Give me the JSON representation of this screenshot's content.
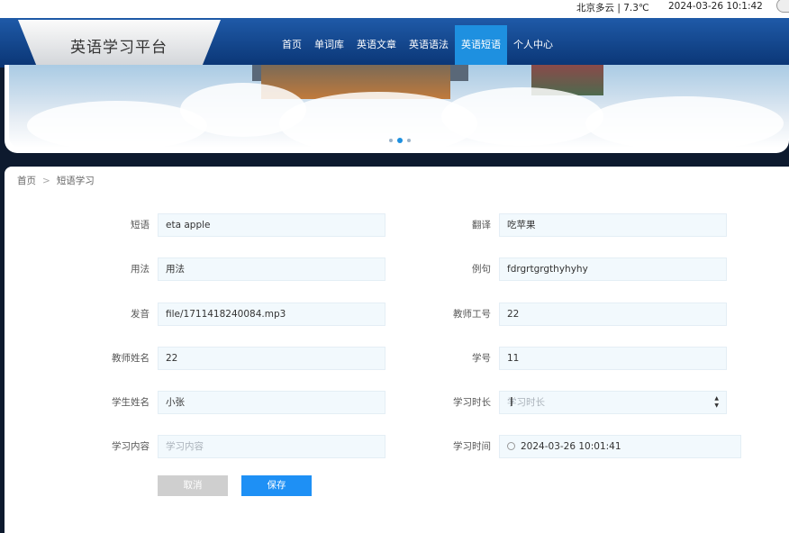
{
  "topbar": {
    "weather": "北京多云 | 7.3℃",
    "datetime": "2024-03-26  10:1:42"
  },
  "header": {
    "site_title": "英语学习平台"
  },
  "nav": [
    "首页",
    "单词库",
    "英语文章",
    "英语语法",
    "英语短语",
    "个人中心"
  ],
  "breadcrumb": {
    "home": "首页",
    "separator": ">",
    "current": "短语学习"
  },
  "form": {
    "phrase": {
      "label": "短语",
      "value": "eta  apple"
    },
    "translation": {
      "label": "翻译",
      "value": "吃苹果"
    },
    "usage": {
      "label": "用法",
      "value": "用法"
    },
    "example": {
      "label": "例句",
      "value": "fdrgrtgrgthyhyhy"
    },
    "audio": {
      "label": "发音",
      "value": "file/1711418240084.mp3"
    },
    "teacher_id": {
      "label": "教师工号",
      "value": "22"
    },
    "teacher_name": {
      "label": "教师姓名",
      "value": "22"
    },
    "student_id": {
      "label": "学号",
      "value": "11"
    },
    "student_name": {
      "label": "学生姓名",
      "value": "小张"
    },
    "study_duration": {
      "label": "学习时长",
      "placeholder": "学习时长"
    },
    "study_content": {
      "label": "学习内容",
      "placeholder": "学习内容"
    },
    "study_time": {
      "label": "学习时间",
      "value": "2024-03-26 10:01:41"
    }
  },
  "buttons": {
    "cancel": "取消",
    "save": "保存"
  },
  "icons": {
    "clock": "clock-icon",
    "spinner": "spinner-arrows-icon"
  },
  "colors": {
    "header": "#0a3574",
    "active_nav": "#1e90e0",
    "save": "#1e90f5",
    "cancel": "#cfcfcf"
  }
}
